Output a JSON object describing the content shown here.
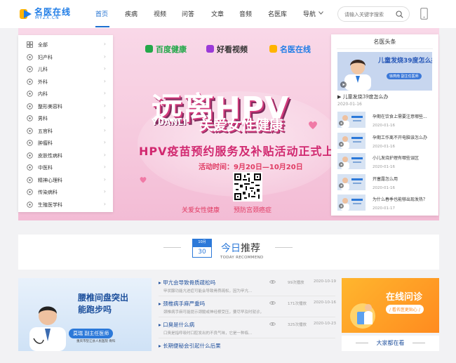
{
  "header": {
    "logo_name": "名医在线",
    "logo_sub": "MYZX.CN",
    "nav": [
      "首页",
      "疾病",
      "视频",
      "问答",
      "文章",
      "音频",
      "名医库",
      "导航"
    ],
    "nav_active": "首页",
    "search_placeholder": "请输入关键字搜索"
  },
  "banner": {
    "brands": [
      "百度健康",
      "好看视频",
      "名医在线"
    ],
    "title": "远离HPV",
    "yuanli": "YUANLI",
    "tagline": "关爱女性健康",
    "headline": "HPV疫苗预约服务及补贴活动正式上线",
    "timeline": "活动时间：9月20日—10月20日",
    "footer_left": "关爱女性健康",
    "footer_right": "预防宫颈癌症",
    "colors": {
      "primary": "#d1286f",
      "bg": "#f7cde0"
    }
  },
  "sidebar": {
    "items": [
      {
        "label": "全部",
        "icon": "grid-icon"
      },
      {
        "label": "妇产科",
        "icon": "female-icon"
      },
      {
        "label": "儿科",
        "icon": "baby-icon"
      },
      {
        "label": "外科",
        "icon": "surgery-icon"
      },
      {
        "label": "内科",
        "icon": "stethoscope-icon"
      },
      {
        "label": "整形美容科",
        "icon": "face-icon"
      },
      {
        "label": "男科",
        "icon": "male-icon"
      },
      {
        "label": "五官科",
        "icon": "ear-icon"
      },
      {
        "label": "肿瘤科",
        "icon": "tumor-icon"
      },
      {
        "label": "皮肤性病科",
        "icon": "skin-icon"
      },
      {
        "label": "中医科",
        "icon": "herb-icon"
      },
      {
        "label": "精神心理科",
        "icon": "brain-icon"
      },
      {
        "label": "传染病科",
        "icon": "virus-icon"
      },
      {
        "label": "生殖医学科",
        "icon": "reproduction-icon"
      }
    ]
  },
  "news": {
    "title": "名医头条",
    "feature": {
      "text": "儿童发烧39度怎么办",
      "badge": "徐燕南  副主任医师",
      "caption": "儿童发烧39度怎么办",
      "date": "2020-01-16"
    },
    "items": [
      {
        "title": "孕期在饮食上需要注意哪些...",
        "date": "2020-01-16"
      },
      {
        "title": "孕期工作离不开电脑该怎么办",
        "date": "2020-01-16"
      },
      {
        "title": "小儿发烧护理有哪些误区",
        "date": "2020-01-16"
      },
      {
        "title": "开塞露怎么用",
        "date": "2020-01-16"
      },
      {
        "title": "为什么春季也能够出现发热？",
        "date": "2020-01-17"
      }
    ]
  },
  "recommend": {
    "month": "10月",
    "day": "30",
    "title_hl": "今日",
    "title_rest": "推荐",
    "subtitle": "TODAY RECOMMEND"
  },
  "card_left": {
    "title_line1": "腰椎间盘突出",
    "title_line2": "能跑步吗",
    "name": "莫瑞   副主任医师",
    "hospital": "重庆市垫江县人民医院   骨科"
  },
  "articles": [
    {
      "title": "甲亢会导致骨质疏松吗",
      "desc": "甲状腺功能亢进症可能会导致骨质疏松，因为甲亢...",
      "views": "99次播放",
      "date": "2020-10-19"
    },
    {
      "title": "颈椎病手麻严重吗",
      "desc": "颈椎病手麻可能提示颈髓或神经根受压，要尽早及时就诊，颈椎病...",
      "views": "171次播放",
      "date": "2020-10-16"
    },
    {
      "title": "口臭是什么病",
      "desc": "口臭是指呼吸时口腔发出的不良气味，它是一种临...",
      "views": "325次播放",
      "date": "2020-10-23"
    },
    {
      "title": "长期便秘会引起什么后果",
      "desc": "",
      "views": "",
      "date": ""
    }
  ],
  "card_right": {
    "title": "在线问诊",
    "subtitle": "/ 看名医更贴心 /"
  },
  "watch_title": "大家都在看"
}
